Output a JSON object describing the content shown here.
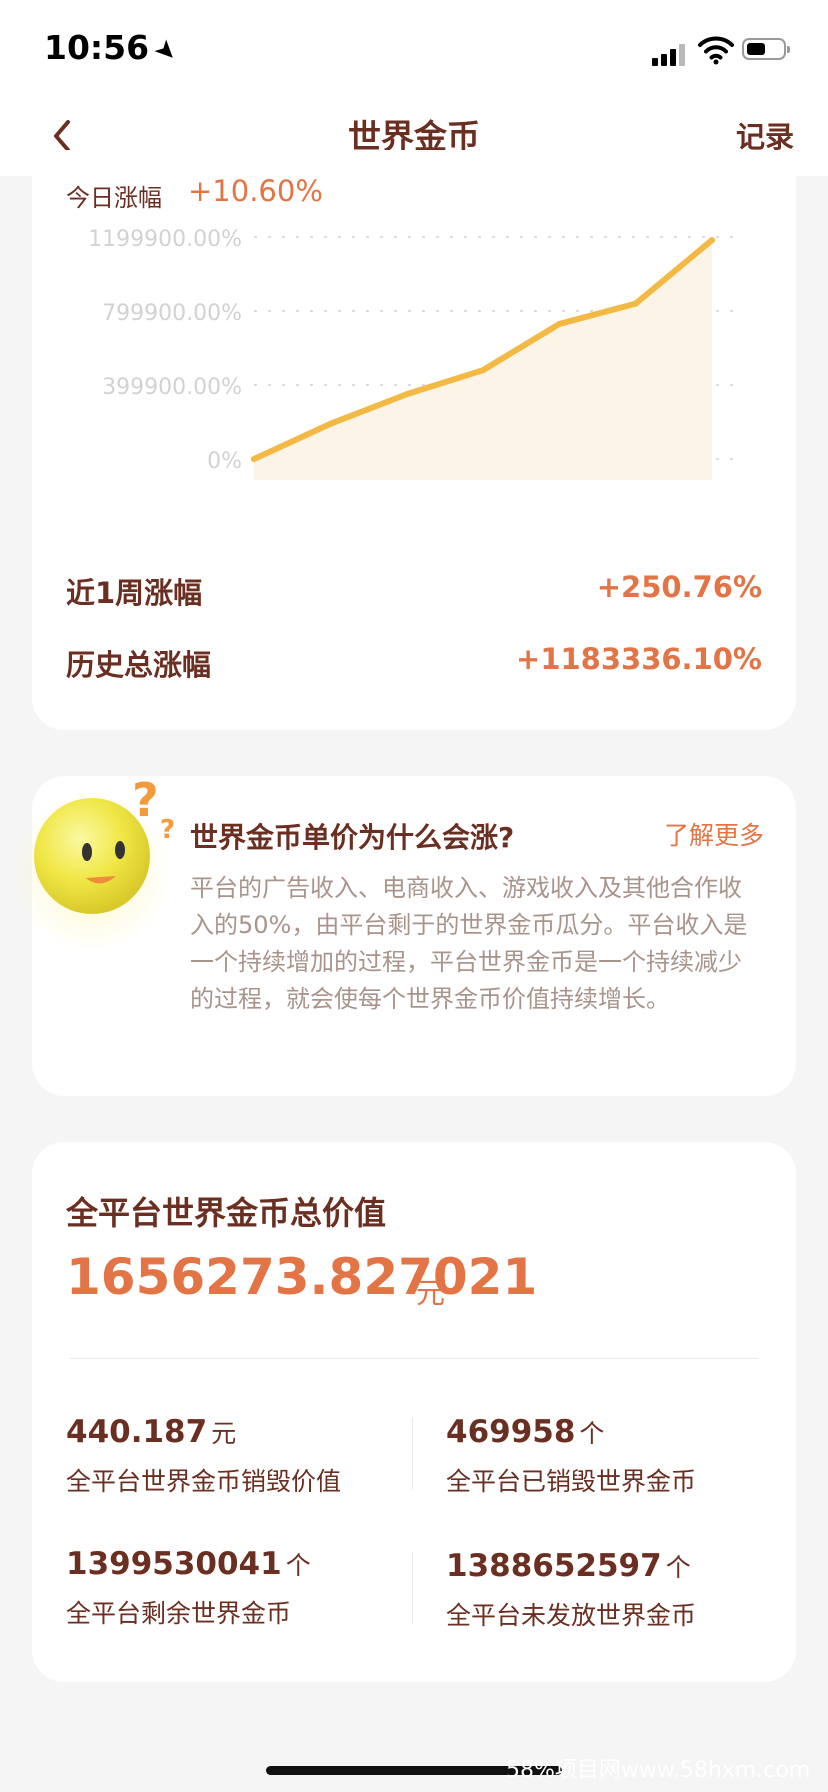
{
  "status_bar": {
    "time": "10:56"
  },
  "nav": {
    "title": "世界金币",
    "record_label": "记录"
  },
  "chart_card": {
    "today_label": "今日涨幅",
    "today_value": "+10.60%",
    "week_label": "近1周涨幅",
    "week_value": "+250.76%",
    "history_label": "历史总涨幅",
    "history_value": "+1183336.10%"
  },
  "chart_data": {
    "type": "area",
    "y_tick_labels": [
      "1199900.00%",
      "799900.00%",
      "399900.00%",
      "0%"
    ],
    "ylim": [
      0,
      1199900
    ],
    "grid": true,
    "color": "#f3b945",
    "fill": "#fdf4e8",
    "series": [
      {
        "values": [
          0,
          190000,
          350000,
          480000,
          730000,
          840000,
          1183336
        ]
      }
    ]
  },
  "why_card": {
    "title": "世界金币单价为什么会涨?",
    "link": "了解更多",
    "description": "平台的广告收入、电商收入、游戏收入及其他合作收入的50%，由平台剩于的世界金币瓜分。平台收入是一个持续增加的过程，平台世界金币是一个持续减少的过程，就会使每个世界金币价值持续增长。"
  },
  "total_card": {
    "title": "全平台世界金币总价值",
    "value": "1656273.827021",
    "unit": "元",
    "stats": [
      {
        "num": "440.187",
        "unit": "元",
        "desc": "全平台世界金币销毁价值"
      },
      {
        "num": "469958",
        "unit": "个",
        "desc": "全平台已销毁世界金币"
      },
      {
        "num": "1399530041",
        "unit": "个",
        "desc": "全平台剩余世界金币"
      },
      {
        "num": "1388652597",
        "unit": "个",
        "desc": "全平台未发放世界金币"
      }
    ]
  },
  "watermark": "58%项目网www.58hxm.com",
  "colors": {
    "accent": "#e27445",
    "text": "#6b2f22",
    "muted": "#a9948c",
    "line": "#f3b945"
  }
}
